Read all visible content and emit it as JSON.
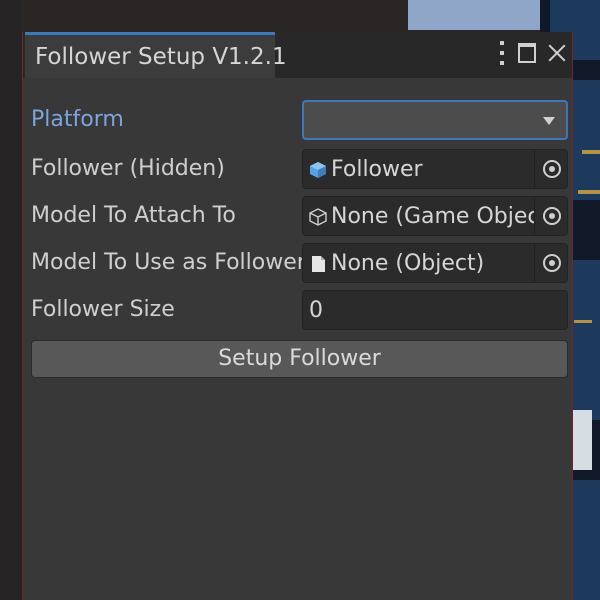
{
  "window": {
    "tab_title": "Follower Setup V1.2.1"
  },
  "fields": [
    {
      "label": "Platform",
      "type": "dropdown",
      "value": ""
    },
    {
      "label": "Follower (Hidden)",
      "type": "object",
      "value": "Follower",
      "icon": "prefab-cube-icon"
    },
    {
      "label": "Model To Attach To",
      "type": "object",
      "value": "None (Game Object)",
      "icon": "gameobject-cube-icon"
    },
    {
      "label": "Model To Use as Follower",
      "type": "object",
      "value": "None (Object)",
      "icon": "document-icon"
    },
    {
      "label": "Follower Size",
      "type": "number",
      "value": "0"
    }
  ],
  "setup_button_label": "Setup Follower",
  "colors": {
    "accent": "#3a79bb",
    "active_label": "#7ba5dc",
    "panel_bg": "#383838",
    "field_bg": "#2b2b2b",
    "prefab_icon": "#5aa3e0"
  }
}
